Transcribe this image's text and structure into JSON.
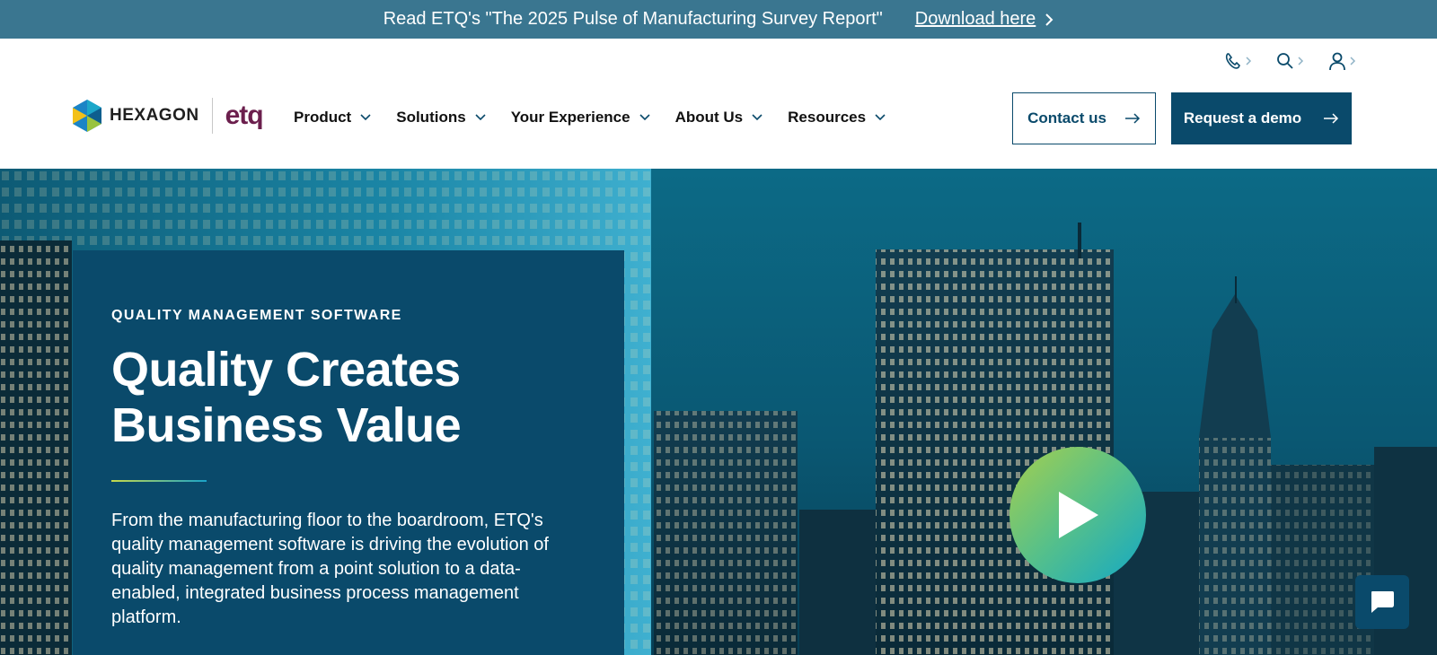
{
  "announcement": {
    "message": "Read ETQ's \"The 2025 Pulse of Manufacturing Survey Report\"",
    "link_label": "Download here"
  },
  "utility": {
    "icons": [
      "phone-icon",
      "search-icon",
      "user-icon"
    ]
  },
  "logo": {
    "hexagon": "HEXAGON",
    "etq": "etq"
  },
  "nav": {
    "items": [
      {
        "label": "Product"
      },
      {
        "label": "Solutions"
      },
      {
        "label": "Your Experience"
      },
      {
        "label": "About Us"
      },
      {
        "label": "Resources"
      }
    ]
  },
  "cta": {
    "contact_label": "Contact us",
    "demo_label": "Request a demo"
  },
  "hero": {
    "eyebrow": "QUALITY MANAGEMENT SOFTWARE",
    "title_line1": "Quality Creates",
    "title_line2": "Business Value",
    "body": "From the manufacturing floor to the boardroom, ETQ's quality management software is driving the evolution of quality management from a point solution to a data-enabled, integrated business process management platform."
  },
  "colors": {
    "brand_navy": "#0a4a6b",
    "announce_bg": "#3a7690",
    "etq_purple": "#6b1f4d",
    "play_gradient_start": "#a6cf4d",
    "play_gradient_end": "#12a8c6"
  }
}
